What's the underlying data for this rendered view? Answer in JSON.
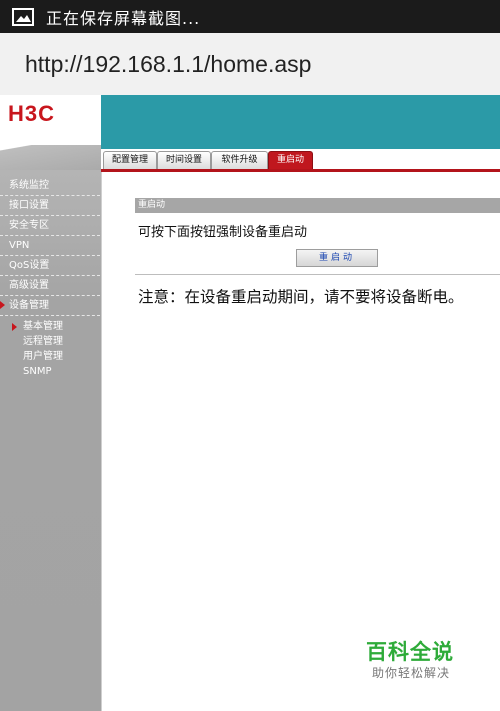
{
  "status_bar": {
    "icon": "image-icon",
    "text": "正在保存屏幕截图..."
  },
  "address_bar": {
    "url": "http://192.168.1.1/home.asp"
  },
  "brand": {
    "logo_text": "H3C",
    "logo_color": "#c8161d",
    "header_color": "#2b9aa7"
  },
  "sidebar": {
    "items": [
      {
        "label": "系统监控"
      },
      {
        "label": "接口设置"
      },
      {
        "label": "安全专区"
      },
      {
        "label": "VPN"
      },
      {
        "label": "QoS设置"
      },
      {
        "label": "高级设置"
      },
      {
        "label": "设备管理"
      }
    ],
    "sub_items": [
      {
        "label": "基本管理"
      },
      {
        "label": "远程管理"
      },
      {
        "label": "用户管理"
      },
      {
        "label": "SNMP"
      }
    ]
  },
  "tabs": [
    {
      "label": "配置管理"
    },
    {
      "label": "时间设置"
    },
    {
      "label": "软件升级"
    },
    {
      "label": "重启动"
    }
  ],
  "main": {
    "section_title": "重启动",
    "instruction": "可按下面按钮强制设备重启动",
    "restart_button": "重启动",
    "notice": "注意：在设备重启动期间，请不要将设备断电。"
  },
  "watermark": {
    "title": "百科全说",
    "subtitle": "助你轻松解决"
  }
}
